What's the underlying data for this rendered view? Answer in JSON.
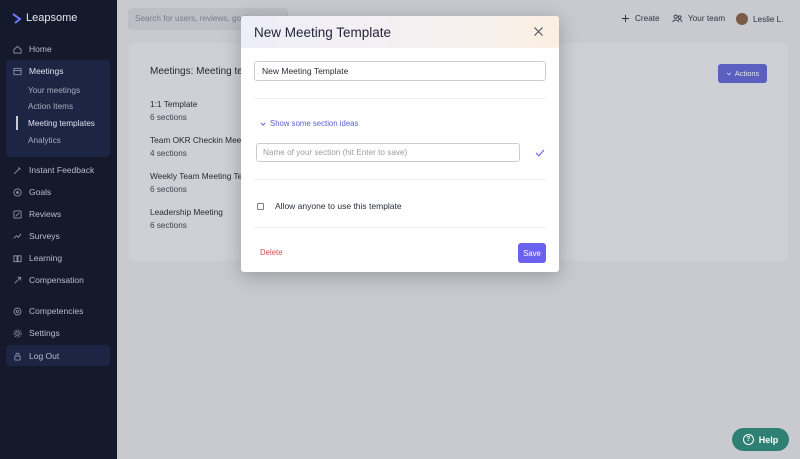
{
  "app": {
    "logo_text": "Leapsome"
  },
  "colors": {
    "sidebar_bg": "#141a2c",
    "accent": "#6a62ef",
    "danger": "#d84a4a",
    "help_bg": "#2e7f74"
  },
  "sidebar": {
    "items": [
      {
        "label": "Home",
        "icon": "home-icon"
      },
      {
        "label": "Meetings",
        "icon": "meetings-icon"
      },
      {
        "label": "Instant Feedback",
        "icon": "feedback-icon"
      },
      {
        "label": "Goals",
        "icon": "goals-icon"
      },
      {
        "label": "Reviews",
        "icon": "reviews-icon"
      },
      {
        "label": "Surveys",
        "icon": "surveys-icon"
      },
      {
        "label": "Learning",
        "icon": "learning-icon"
      },
      {
        "label": "Compensation",
        "icon": "compensation-icon"
      },
      {
        "label": "Competencies",
        "icon": "competencies-icon"
      },
      {
        "label": "Settings",
        "icon": "settings-icon"
      },
      {
        "label": "Log Out",
        "icon": "lock-icon"
      }
    ],
    "meetings_sub": [
      {
        "label": "Your meetings"
      },
      {
        "label": "Action Items"
      },
      {
        "label": "Meeting templates",
        "active": true
      },
      {
        "label": "Analytics"
      }
    ]
  },
  "topbar": {
    "search_placeholder": "Search for users, reviews, goals...",
    "create_label": "Create",
    "team_label": "Your team",
    "user_label": "Leslie L."
  },
  "background": {
    "title": "Meetings: Meeting templates",
    "actions_label": "Actions",
    "templates": [
      {
        "name": "1:1 Template",
        "count": "6 sections"
      },
      {
        "name": "Team OKR Checkin Meeting",
        "count": "4 sections"
      },
      {
        "name": "Weekly Team Meeting Template",
        "count": "6 sections"
      },
      {
        "name": "Leadership Meeting",
        "count": "6 sections"
      }
    ]
  },
  "modal": {
    "title": "New Meeting Template",
    "name_value": "New Meeting Template",
    "ideas_link": "Show some section ideas",
    "section_placeholder": "Name of your section (hit Enter to save)",
    "allow_label": "Allow anyone to use this template",
    "allow_checked": false,
    "delete_label": "Delete",
    "save_label": "Save"
  },
  "help": {
    "label": "Help"
  }
}
